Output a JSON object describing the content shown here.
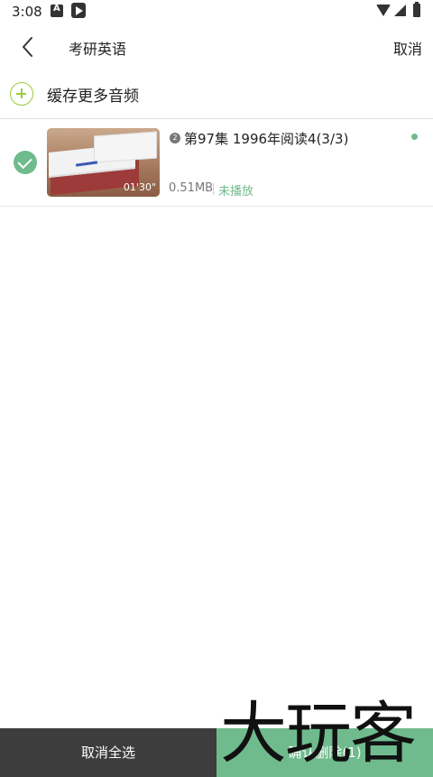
{
  "status_bar": {
    "time": "3:08",
    "notification_icons": [
      "a-app-icon",
      "play-store-icon"
    ],
    "system_icons": [
      "wifi-icon",
      "signal-icon",
      "battery-icon"
    ]
  },
  "header": {
    "back_icon": "chevron-left-icon",
    "title": "考研英语",
    "cancel_label": "取消"
  },
  "cache_more": {
    "icon": "plus-circle-icon",
    "label": "缓存更多音频"
  },
  "audio_items": [
    {
      "selected": true,
      "order_badge": "2",
      "title": "第97集 1996年阅读4(3/3)",
      "duration": "01'30\"",
      "size": "0.51MB",
      "status": "未播放",
      "unread": true
    }
  ],
  "bottom_bar": {
    "deselect_all_label": "取消全选",
    "confirm_delete_label": "确认删除(1)"
  },
  "watermark": {
    "text": "大玩客"
  },
  "colors": {
    "accent_green": "#6fbb8d",
    "plus_green": "#9ccb3c",
    "dark_button": "#3d3d3d"
  }
}
